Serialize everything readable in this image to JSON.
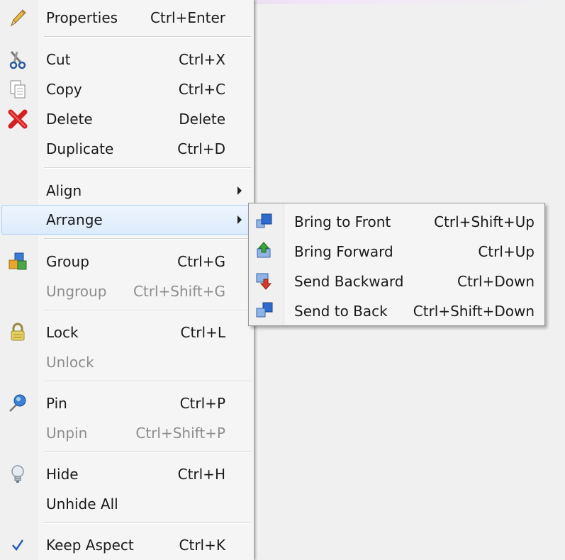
{
  "menu": {
    "items": [
      {
        "label": "Properties",
        "shortcut": "Ctrl+Enter",
        "icon": "pencil-icon"
      },
      {
        "label": "Cut",
        "shortcut": "Ctrl+X",
        "icon": "scissors-icon"
      },
      {
        "label": "Copy",
        "shortcut": "Ctrl+C",
        "icon": "copy-icon"
      },
      {
        "label": "Delete",
        "shortcut": "Delete",
        "icon": "delete-x-icon"
      },
      {
        "label": "Duplicate",
        "shortcut": "Ctrl+D"
      },
      {
        "label": "Align"
      },
      {
        "label": "Arrange"
      },
      {
        "label": "Group",
        "shortcut": "Ctrl+G",
        "icon": "group-icon"
      },
      {
        "label": "Ungroup",
        "shortcut": "Ctrl+Shift+G",
        "disabled": true
      },
      {
        "label": "Lock",
        "shortcut": "Ctrl+L",
        "icon": "lock-icon"
      },
      {
        "label": "Unlock",
        "disabled": true
      },
      {
        "label": "Pin",
        "shortcut": "Ctrl+P",
        "icon": "pin-icon"
      },
      {
        "label": "Unpin",
        "shortcut": "Ctrl+Shift+P",
        "disabled": true
      },
      {
        "label": "Hide",
        "shortcut": "Ctrl+H",
        "icon": "lightbulb-icon"
      },
      {
        "label": "Unhide All"
      },
      {
        "label": "Keep Aspect",
        "shortcut": "Ctrl+K",
        "icon": "checkmark-icon",
        "checked": true
      }
    ]
  },
  "submenu": {
    "parent": "Arrange",
    "items": [
      {
        "label": "Bring to Front",
        "shortcut": "Ctrl+Shift+Up",
        "icon": "bring-to-front-icon"
      },
      {
        "label": "Bring Forward",
        "shortcut": "Ctrl+Up",
        "icon": "bring-forward-icon"
      },
      {
        "label": "Send Backward",
        "shortcut": "Ctrl+Down",
        "icon": "send-backward-icon"
      },
      {
        "label": "Send to Back",
        "shortcut": "Ctrl+Shift+Down",
        "icon": "send-to-back-icon"
      }
    ]
  },
  "colors": {
    "highlight_border": "#aecff7",
    "disabled_text": "#8d8d8d",
    "delete_red": "#d42020",
    "check_blue": "#2a5bb8"
  }
}
